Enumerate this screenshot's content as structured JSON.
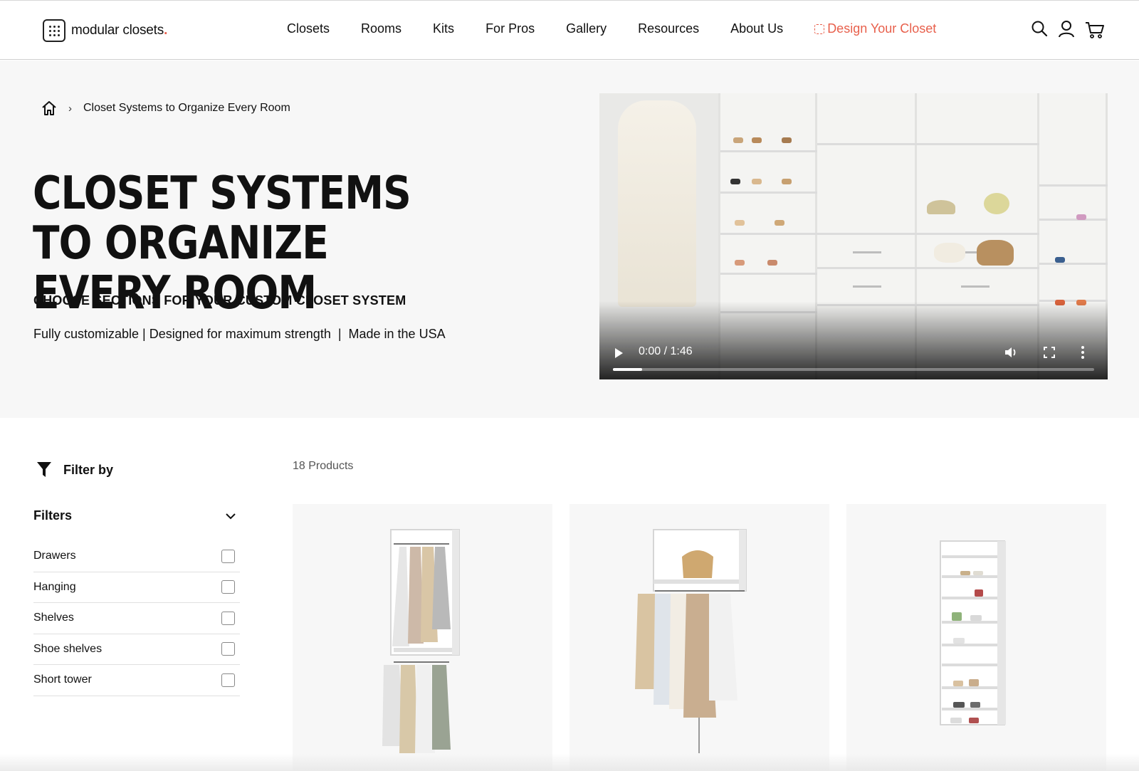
{
  "header": {
    "logo_text": "modular closets",
    "logo_dot": ".",
    "nav": [
      "Closets",
      "Rooms",
      "Kits",
      "For Pros",
      "Gallery",
      "Resources",
      "About Us"
    ],
    "design_cta": "Design Your Closet",
    "icons": [
      "search-icon",
      "account-icon",
      "cart-icon"
    ],
    "accent_color": "#e8604c"
  },
  "breadcrumb": {
    "current": "Closet Systems to Organize Every Room",
    "separator": "›"
  },
  "hero": {
    "title_line1": "Closet Systems to Organize",
    "title_line2": "Every Room",
    "subtitle": "CHOOSE SECTIONS FOR YOUR CUSTOM CLOSET SYSTEM",
    "tagline": "Fully customizable | Designed for maximum strength  |  Made in the USA"
  },
  "video": {
    "time": "0:00 / 1:46",
    "progress": 0.06
  },
  "filters": {
    "heading": "Filter by",
    "group_title": "Filters",
    "options": [
      "Drawers",
      "Hanging",
      "Shelves",
      "Shoe shelves",
      "Short tower"
    ]
  },
  "products": {
    "count_label": "18 Products"
  }
}
